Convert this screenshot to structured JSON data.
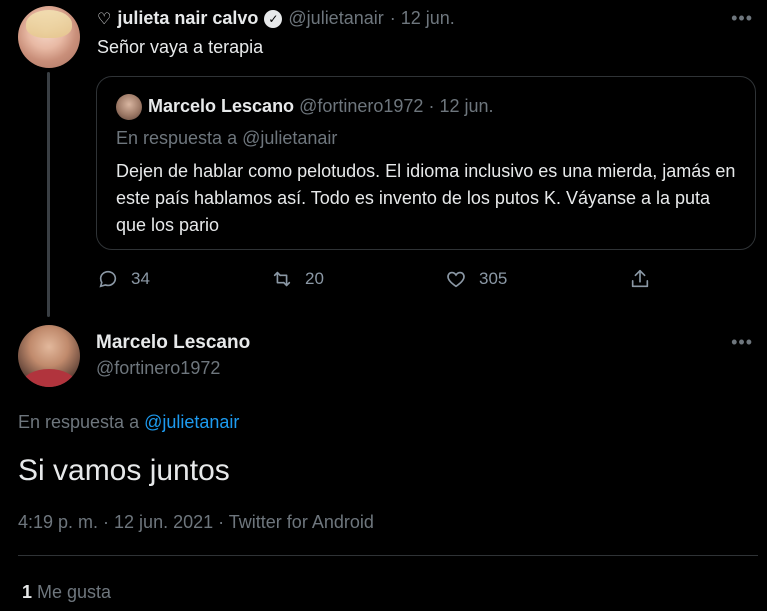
{
  "quoting_tweet": {
    "avatar_icon": "profile-photo-woman",
    "name_icon": "heart-outline-icon",
    "display_name": "julieta nair calvo",
    "verified_icon": "verified-badge-icon",
    "handle": "@julietanair",
    "date": "· 12 jun.",
    "more": "•••",
    "text": "Señor vaya a terapia",
    "actions": {
      "reply_count": "34",
      "retweet_count": "20",
      "like_count": "305"
    }
  },
  "quoted_tweet": {
    "avatar_icon": "profile-photo-man",
    "display_name": "Marcelo Lescano",
    "handle": "@fortinero1972",
    "date": "· 12 jun.",
    "reply_prefix": "En respuesta a @julietanair",
    "text": "Dejen de hablar como pelotudos. El idioma inclusivo es una mierda, jamás en este país hablamos así. Todo es invento de los putos K. Váyanse a la puta que los pario"
  },
  "main_tweet": {
    "avatar_icon": "profile-photo-man",
    "display_name": "Marcelo Lescano",
    "handle": "@fortinero1972",
    "more": "•••",
    "reply_prefix": "En respuesta a",
    "reply_handle": "@julietanair",
    "text": "Si vamos juntos",
    "meta": "4:19 p. m. · 12 jun. 2021 · Twitter for Android",
    "likes_count": "1",
    "likes_label": "Me gusta"
  },
  "colors": {
    "background": "#000000",
    "text": "#e7e9ea",
    "muted": "#6e767d",
    "link": "#1d9bf0",
    "border": "#2f3336"
  }
}
